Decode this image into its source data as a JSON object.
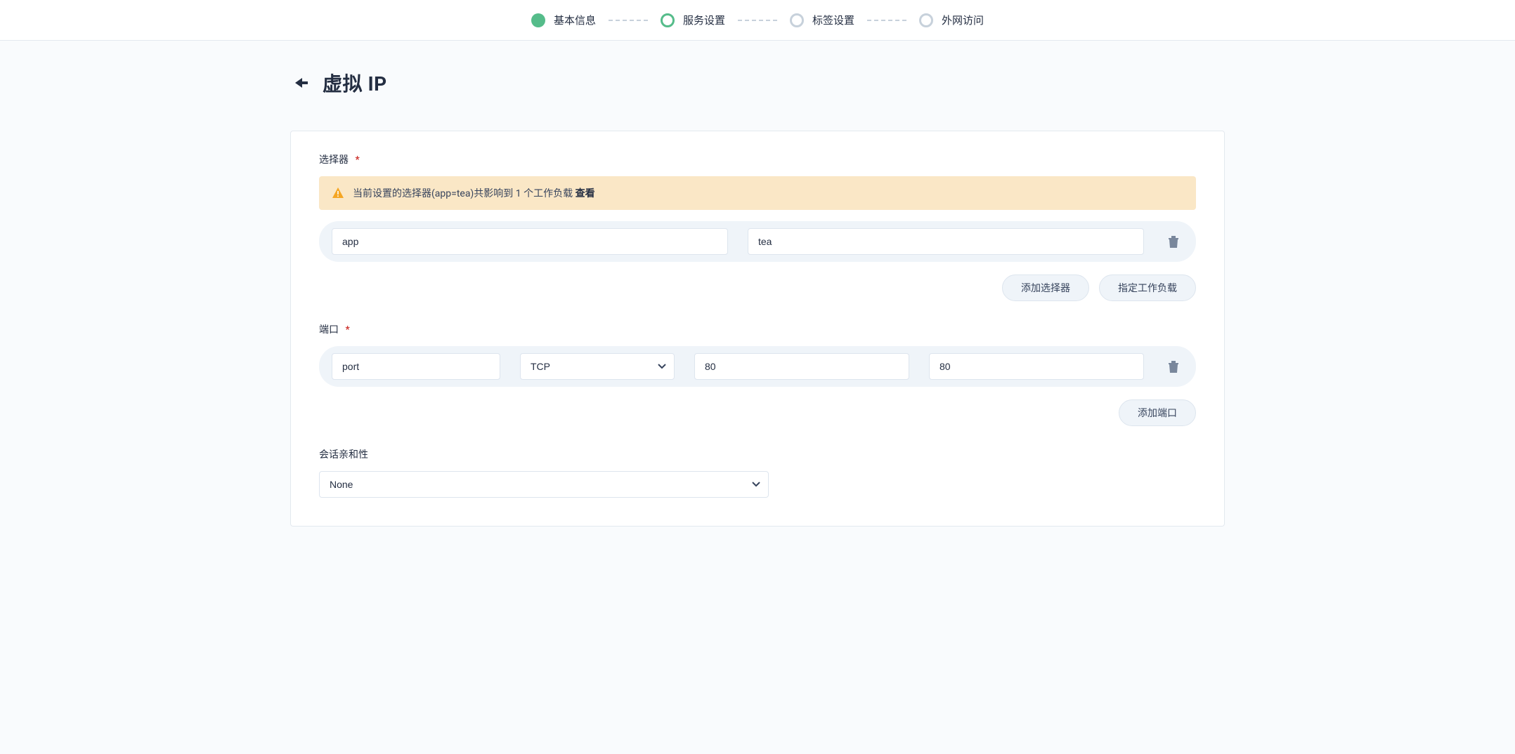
{
  "steps": {
    "s1": "基本信息",
    "s2": "服务设置",
    "s3": "标签设置",
    "s4": "外网访问"
  },
  "page": {
    "title": "虚拟 IP"
  },
  "selector": {
    "label": "选择器",
    "banner_text": "当前设置的选择器(app=tea)共影响到 1 个工作负载",
    "banner_link": "查看",
    "key": "app",
    "value": "tea",
    "btn_add": "添加选择器",
    "btn_workload": "指定工作负载"
  },
  "ports": {
    "label": "端口",
    "name": "port",
    "protocol": "TCP",
    "port": "80",
    "target_port": "80",
    "btn_add": "添加端口"
  },
  "session_affinity": {
    "label": "会话亲和性",
    "value": "None"
  }
}
